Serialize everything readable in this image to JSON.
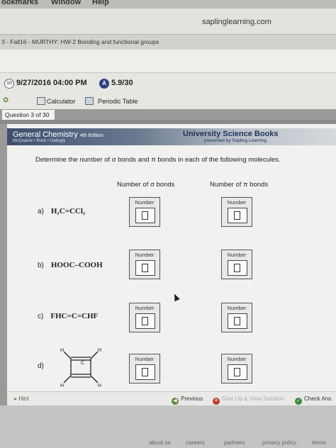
{
  "menubar": {
    "items": [
      "ookmarks",
      "Window",
      "Help"
    ]
  },
  "browser": {
    "url": "saplinglearning.com",
    "tab_title": "3 - Fall16 - MURTHY: HW-2 Bonding and functional groups"
  },
  "assignment": {
    "due_badge": "10",
    "due": "9/27/2016 04:00 PM",
    "score": "5.9/30",
    "tools": {
      "calculator": "Calculator",
      "periodic_table": "Periodic Table"
    }
  },
  "question_tab": "Question 3 of 30",
  "header": {
    "book_title": "General Chemistry",
    "edition": "4th Edition",
    "authors": "McQuarrie • Rock • Gallogly",
    "publisher": "University Science Books",
    "presented_by": "presented by Sapling Learning"
  },
  "question": {
    "instruction": "Determine the number of σ bonds and π bonds in each of the following molecules.",
    "col_sigma": "Number of σ bonds",
    "col_pi": "Number of π bonds",
    "molecules": [
      {
        "label": "a)",
        "formula": "H₂C=CCl₂"
      },
      {
        "label": "b)",
        "formula": "HOOC–COOH"
      },
      {
        "label": "c)",
        "formula": "FHC=C=CHF"
      },
      {
        "label": "d)",
        "formula": ""
      }
    ],
    "input_label": "Number",
    "structure_atoms": {
      "h": "H",
      "c": "C"
    }
  },
  "bottombar": {
    "hint": "Hint",
    "previous": "Previous",
    "give_up": "Give Up & View Solution",
    "check": "Check Ans"
  },
  "footer": {
    "links": [
      "about us",
      "careers",
      "partners",
      "privacy policy",
      "terms"
    ]
  }
}
